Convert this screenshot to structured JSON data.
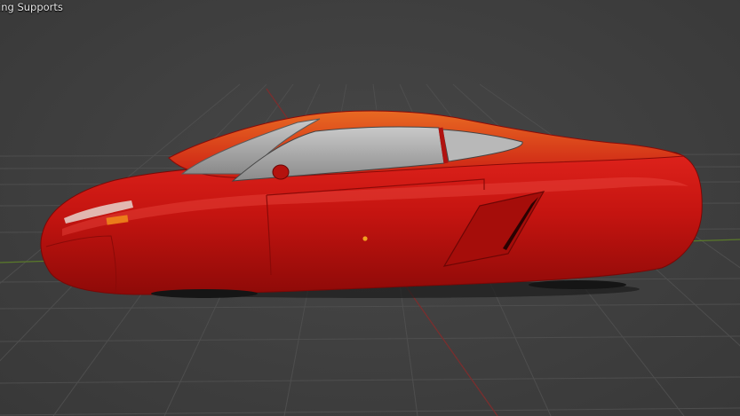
{
  "viewport": {
    "overlay_text": "ing Supports",
    "background_color": "#3d3d3d",
    "grid_color": "#4e4e4e",
    "x_axis_color": "#7a2e2e",
    "y_axis_color": "#5a7a2a"
  },
  "object": {
    "kind": "car-model",
    "body_color": "#c81414",
    "origin_color": "#f0a020"
  }
}
